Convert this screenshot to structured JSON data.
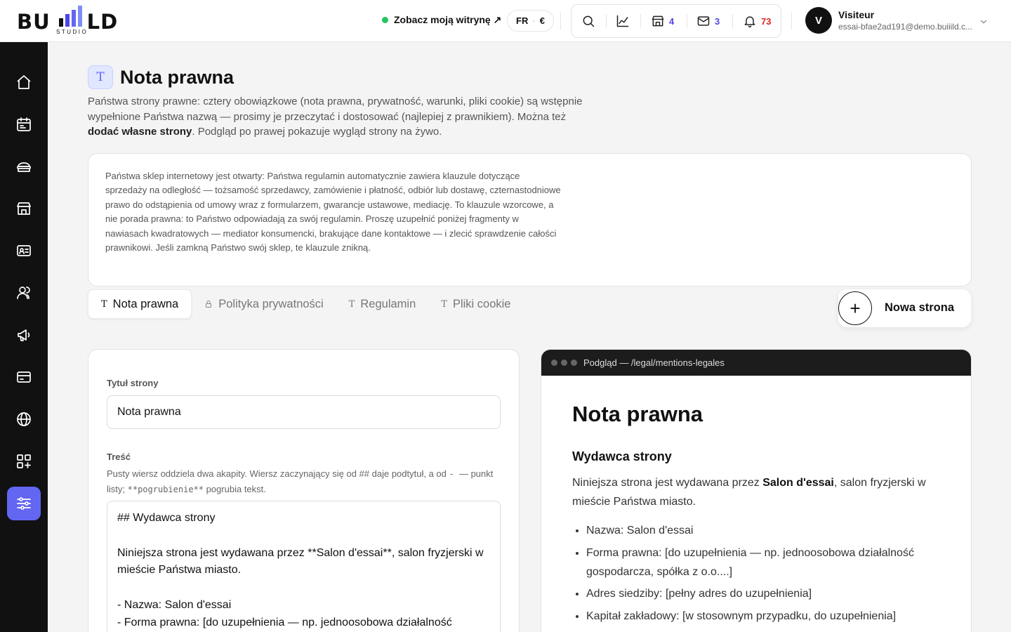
{
  "brand": {
    "logo_text_left": "BU",
    "logo_text_right": "LD",
    "logo_sub": "STUDIO",
    "accent": "#6366f1"
  },
  "header": {
    "view_site": "Zobacz moją witrynę ↗",
    "locale_lang": "FR",
    "locale_sep": "·",
    "locale_currency": "€",
    "tools": [
      {
        "icon": "search-icon"
      },
      {
        "icon": "chart-icon"
      },
      {
        "icon": "store-icon",
        "count": "4"
      },
      {
        "icon": "mail-icon",
        "count": "3"
      },
      {
        "icon": "bell-icon",
        "count": "73"
      }
    ],
    "user": {
      "initial": "V",
      "name": "Visiteur",
      "email": "essai-bfae2ad191@demo.buiiild.c..."
    }
  },
  "sidebar": {
    "items": [
      {
        "icon": "home-icon"
      },
      {
        "icon": "calendar-icon"
      },
      {
        "icon": "services-icon"
      },
      {
        "icon": "store-icon"
      },
      {
        "icon": "contact-card-icon"
      },
      {
        "icon": "users-icon"
      },
      {
        "icon": "megaphone-icon"
      },
      {
        "icon": "payment-card-icon"
      },
      {
        "icon": "globe-icon"
      },
      {
        "icon": "apps-icon"
      },
      {
        "icon": "settings-sliders-icon",
        "active": true
      }
    ]
  },
  "page": {
    "title_icon": "T",
    "title": "Nota prawna",
    "desc_1": "Państwa strony prawne: cztery obowiązkowe (nota prawna, prywatność, warunki, pliki cookie) są wstępnie wypełnione Państwa nazwą — prosimy je przeczytać i dostosować (najlepiej z prawnikiem). Można też ",
    "desc_bold": "dodać własne strony",
    "desc_2": ". Podgląd po prawej pokazuje wygląd strony na żywo."
  },
  "notice": "Państwa sklep internetowy jest otwarty: Państwa regulamin automatycznie zawiera klauzule dotyczące sprzedaży na odległość — tożsamość sprzedawcy, zamówienie i płatność, odbiór lub dostawę, czternastodniowe prawo do odstąpienia od umowy wraz z formularzem, gwarancje ustawowe, mediację. To klauzule wzorcowe, a nie porada prawna: to Państwo odpowiadają za swój regulamin. Proszę uzupełnić poniżej fragmenty w nawiasach kwadratowych — mediator konsumencki, brakujące dane kontaktowe — i zlecić sprawdzenie całości prawnikowi. Jeśli zamkną Państwo swój sklep, te klauzule znikną.",
  "tabs": [
    {
      "icon": "text-icon",
      "label": "Nota prawna",
      "active": true
    },
    {
      "icon": "lock-icon",
      "label": "Polityka prywatności"
    },
    {
      "icon": "text-icon",
      "label": "Regulamin"
    },
    {
      "icon": "text-icon",
      "label": "Pliki cookie"
    }
  ],
  "new_page": {
    "plus": "+",
    "label": "Nowa strona"
  },
  "editor": {
    "title_label": "Tytuł strony",
    "title_value": "Nota prawna",
    "content_label": "Treść",
    "hint_1": "Pusty wiersz oddziela dwa akapity. Wiersz zaczynający się od ## daje podtytuł, a od ",
    "hint_code_1": "- ",
    "hint_2": " — punkt listy; ",
    "hint_code_2": "**pogrubienie**",
    "hint_3": " pogrubia tekst.",
    "content_value": "## Wydawca strony\n\nNiniejsza strona jest wydawana przez **Salon d'essai**, salon fryzjerski w mieście Państwa miasto.\n\n- Nazwa: Salon d'essai\n- Forma prawna: [do uzupełnienia — np. jednoosobowa działalność"
  },
  "preview": {
    "path": "Podgląd — /legal/mentions-legales",
    "h1": "Nota prawna",
    "h2": "Wydawca strony",
    "p_1": "Niniejsza strona jest wydawana przez ",
    "p_bold": "Salon d'essai",
    "p_2": ", salon fryzjerski w mieście Państwa miasto.",
    "list": [
      "Nazwa: Salon d'essai",
      "Forma prawna: [do uzupełnienia — np. jednoosobowa działalność gospodarcza, spółka z o.o....]",
      "Adres siedziby: [pełny adres do uzupełnienia]",
      "Kapitał zakładowy: [w stosownym przypadku, do uzupełnienia]"
    ]
  }
}
